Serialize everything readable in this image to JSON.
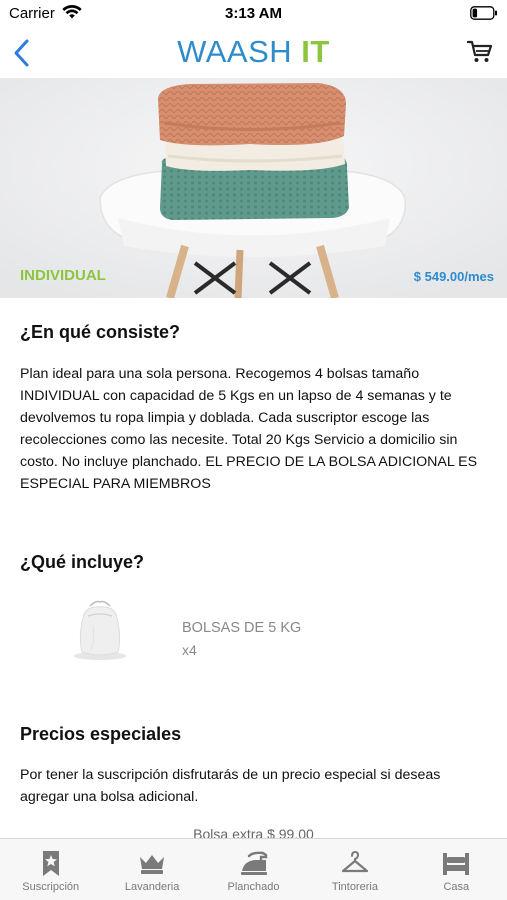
{
  "status_bar": {
    "carrier": "Carrier",
    "time": "3:13 AM"
  },
  "header": {
    "brand_primary": "WAASH",
    "brand_accent": "IT"
  },
  "hero": {
    "plan_name": "INDIVIDUAL",
    "price": "$ 549.00/mes"
  },
  "sections": {
    "what_is": {
      "title": "¿En qué consiste?",
      "lines": [
        "Plan ideal para una sola persona. Recogemos 4 bolsas tamaño",
        "INDIVIDUAL con capacidad de 5 Kgs en un lapso de 4 semanas y te",
        "devolvemos tu ropa limpia y doblada. Cada suscriptor escoge las",
        "recolecciones como las necesite. Total 20 Kgs Servicio a domicilio sin",
        "costo. No incluye planchado. EL PRECIO DE LA BOLSA ADICIONAL ES",
        "ESPECIAL PARA MIEMBROS"
      ]
    },
    "includes": {
      "title": "¿Qué incluye?",
      "item": {
        "name": "BOLSAS DE 5 KG",
        "qty": "x4"
      }
    },
    "special_prices": {
      "title": "Precios especiales",
      "lines": [
        "Por tener la suscripción disfrutarás de un precio especial si deseas",
        "agregar una bolsa adicional."
      ],
      "extra_bag": "Bolsa extra $ 99.00"
    }
  },
  "tabs": [
    {
      "label": "Suscripción",
      "icon": "bookmark-star-icon"
    },
    {
      "label": "Lavanderia",
      "icon": "crown-basket-icon"
    },
    {
      "label": "Planchado",
      "icon": "iron-icon"
    },
    {
      "label": "Tintoreria",
      "icon": "hanger-icon"
    },
    {
      "label": "Casa",
      "icon": "bed-icon"
    }
  ],
  "colors": {
    "brand_blue": "#2f8ccc",
    "brand_green": "#8cc63f",
    "back_blue": "#2f7ce0"
  }
}
